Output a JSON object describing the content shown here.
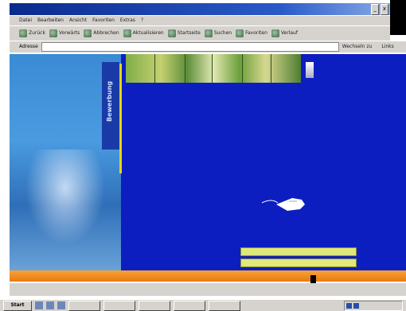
{
  "window": {
    "title": "",
    "buttons": [
      "_",
      "x"
    ]
  },
  "menubar": {
    "items": [
      {
        "label": "Datei"
      },
      {
        "label": "Bearbeiten"
      },
      {
        "label": "Ansicht"
      },
      {
        "label": "Favoriten"
      },
      {
        "label": "Extras"
      },
      {
        "label": "?"
      }
    ]
  },
  "toolbar": {
    "items": [
      {
        "label": "Zurück"
      },
      {
        "label": "Vorwärts"
      },
      {
        "label": "Abbrechen"
      },
      {
        "label": "Aktualisieren"
      },
      {
        "label": "Startseite"
      },
      {
        "label": "Suchen"
      },
      {
        "label": "Favoriten"
      },
      {
        "label": "Verlauf"
      }
    ]
  },
  "address": {
    "label": "Adresse",
    "value": "",
    "go": "Wechseln zu",
    "links": "Links"
  },
  "page": {
    "vertical_label": "Bewerbung",
    "logo_line1": "",
    "logo_line2": "",
    "heading": "",
    "lines": [
      {
        "strong": "",
        "rest": ""
      },
      {
        "strong": "",
        "rest": ""
      },
      {
        "strong": "",
        "rest": ""
      },
      {
        "strong": "",
        "rest": ""
      }
    ],
    "form_label": "",
    "field1_label": "",
    "field2_label": "",
    "field1_value": "",
    "field2_value": ""
  },
  "nav": {
    "items": [
      "",
      "",
      "",
      "",
      "",
      "",
      "",
      ""
    ]
  },
  "status": {
    "text": "",
    "zone": ""
  },
  "taskbar": {
    "start": "Start",
    "tasks": [
      "",
      "",
      "",
      "",
      ""
    ],
    "clock": ""
  },
  "colors": {
    "page_background": "#0d1ec0",
    "nav_orange": "#ea7a10",
    "heading_orange": "#ff9a3c",
    "field_yellow": "#dfe87a",
    "accent_yellow_line": "#e6d800"
  },
  "icons": {
    "vertical_label_panel": "left-photo-panel",
    "arrow_image": "hand-cursor-arrow-icon"
  }
}
